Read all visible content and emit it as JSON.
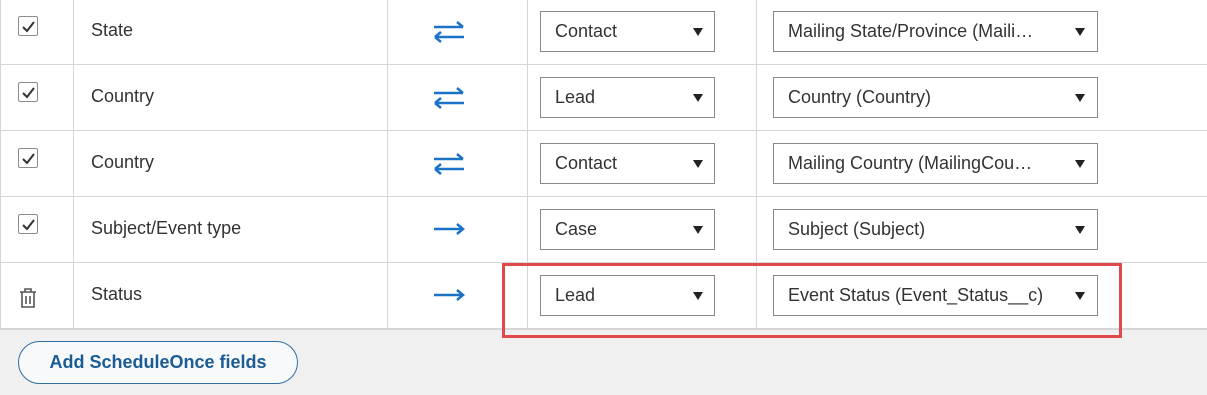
{
  "rows": [
    {
      "selected": true,
      "action_icon": "checkbox-checked",
      "field": "State",
      "direction": "bidirectional-arrow",
      "object": "Contact",
      "mapped_field": "Mailing State/Province (Maili…"
    },
    {
      "selected": true,
      "action_icon": "checkbox-checked",
      "field": "Country",
      "direction": "bidirectional-arrow",
      "object": "Lead",
      "mapped_field": "Country (Country)"
    },
    {
      "selected": true,
      "action_icon": "checkbox-checked",
      "field": "Country",
      "direction": "bidirectional-arrow",
      "object": "Contact",
      "mapped_field": "Mailing Country (MailingCou…"
    },
    {
      "selected": true,
      "action_icon": "checkbox-checked",
      "field": "Subject/Event type",
      "direction": "right-arrow",
      "object": "Case",
      "mapped_field": "Subject (Subject)"
    },
    {
      "selected": false,
      "action_icon": "trash-icon",
      "field": "Status",
      "direction": "right-arrow",
      "object": "Lead",
      "mapped_field": "Event Status (Event_Status__c)"
    }
  ],
  "footer": {
    "add_button_label": "Add ScheduleOnce fields"
  },
  "colors": {
    "arrow": "#1a73c7",
    "highlight": "#e04a4a",
    "button_text": "#1a5c93"
  }
}
